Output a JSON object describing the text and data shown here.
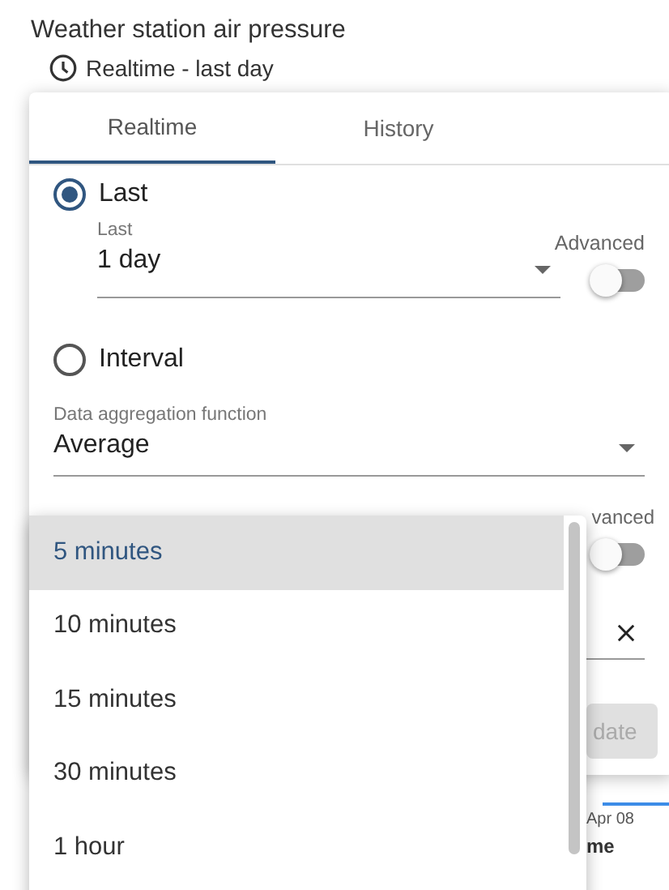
{
  "widget": {
    "title": "Weather station air pressure",
    "timewindow": "Realtime - last day"
  },
  "tabs": [
    {
      "label": "Realtime",
      "selected": true
    },
    {
      "label": "History",
      "selected": false
    }
  ],
  "options": [
    {
      "label": "Last",
      "selected": true
    },
    {
      "label": "Interval",
      "selected": false
    }
  ],
  "last": {
    "label": "Last",
    "value": "1 day"
  },
  "advanced": {
    "label": "Advanced",
    "on": false
  },
  "aggregation": {
    "label": "Data aggregation function",
    "value": "Average"
  },
  "grouping": {
    "advanced_label": "vanced",
    "advanced_on": false
  },
  "update_button": {
    "label": "date",
    "disabled": true
  },
  "chart": {
    "date_label": "Apr 08",
    "legend_text": "me"
  },
  "menu": {
    "items": [
      {
        "label": "5 minutes",
        "selected": true
      },
      {
        "label": "10 minutes",
        "selected": false
      },
      {
        "label": "15 minutes",
        "selected": false
      },
      {
        "label": "30 minutes",
        "selected": false
      },
      {
        "label": "1 hour",
        "selected": false
      }
    ]
  }
}
